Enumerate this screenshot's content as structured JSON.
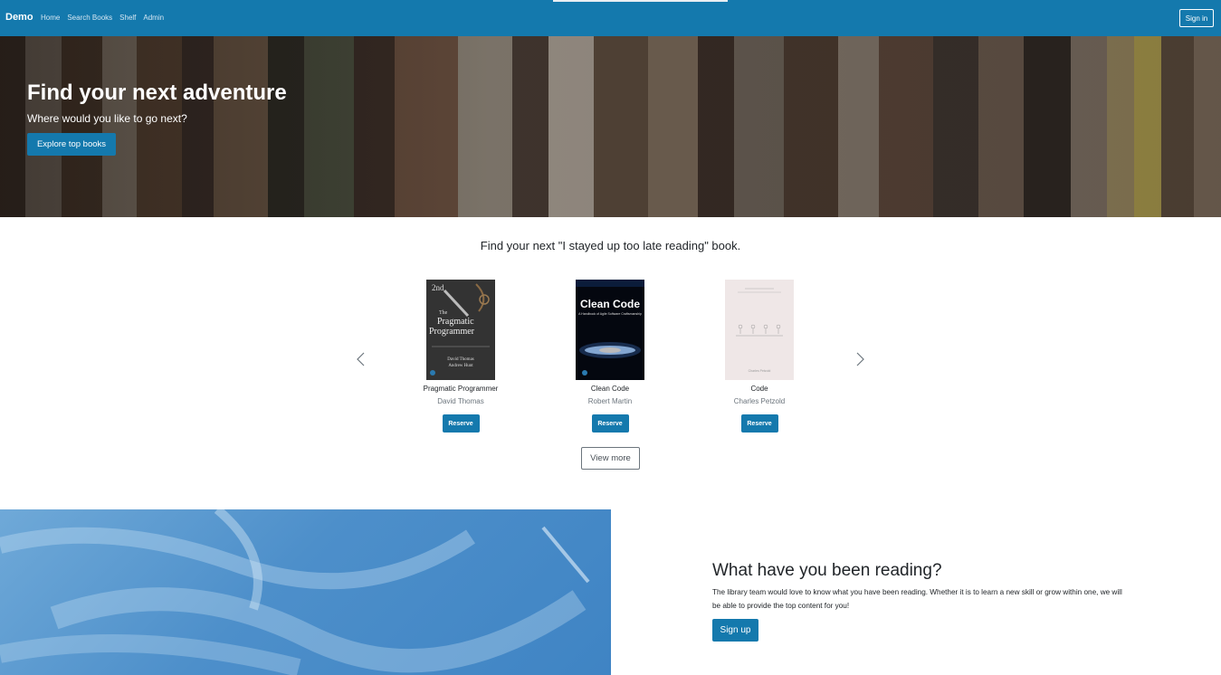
{
  "navbar": {
    "brand": "Demo",
    "links": [
      "Home",
      "Search Books",
      "Shelf",
      "Admin"
    ],
    "signin_label": "Sign in"
  },
  "hero": {
    "title": "Find your next adventure",
    "subtitle": "Where would you like to go next?",
    "button_label": "Explore top books"
  },
  "carousel": {
    "heading": "Find your next \"I stayed up too late reading\" book.",
    "prev_icon": "chevron-left-icon",
    "next_icon": "chevron-right-icon",
    "books": [
      {
        "title": "Pragmatic Programmer",
        "author": "David Thomas",
        "reserve_label": "Reserve",
        "cover": {
          "edition": "2nd",
          "title_line1": "The",
          "title_line2": "Pragmatic",
          "title_line3": "Programmer",
          "author1": "David Thomas",
          "author2": "Andrew Hunt"
        }
      },
      {
        "title": "Clean Code",
        "author": "Robert Martin",
        "reserve_label": "Reserve",
        "cover": {
          "title": "Clean Code",
          "subtitle": "A Handbook of Agile Software Craftsmanship"
        }
      },
      {
        "title": "Code",
        "author": "Charles Petzold",
        "reserve_label": "Reserve",
        "cover": {
          "author": "Charles Petzold"
        }
      }
    ],
    "view_more_label": "View more"
  },
  "cta": {
    "title": "What have you been reading?",
    "text": "The library team would love to know what you have been reading. Whether it is to learn a new skill or grow within one, we will be able to provide the top content for you!",
    "button_label": "Sign up"
  },
  "colors": {
    "primary": "#1479ad",
    "navbar": "#1479ad",
    "sky": "#4d8fca"
  }
}
